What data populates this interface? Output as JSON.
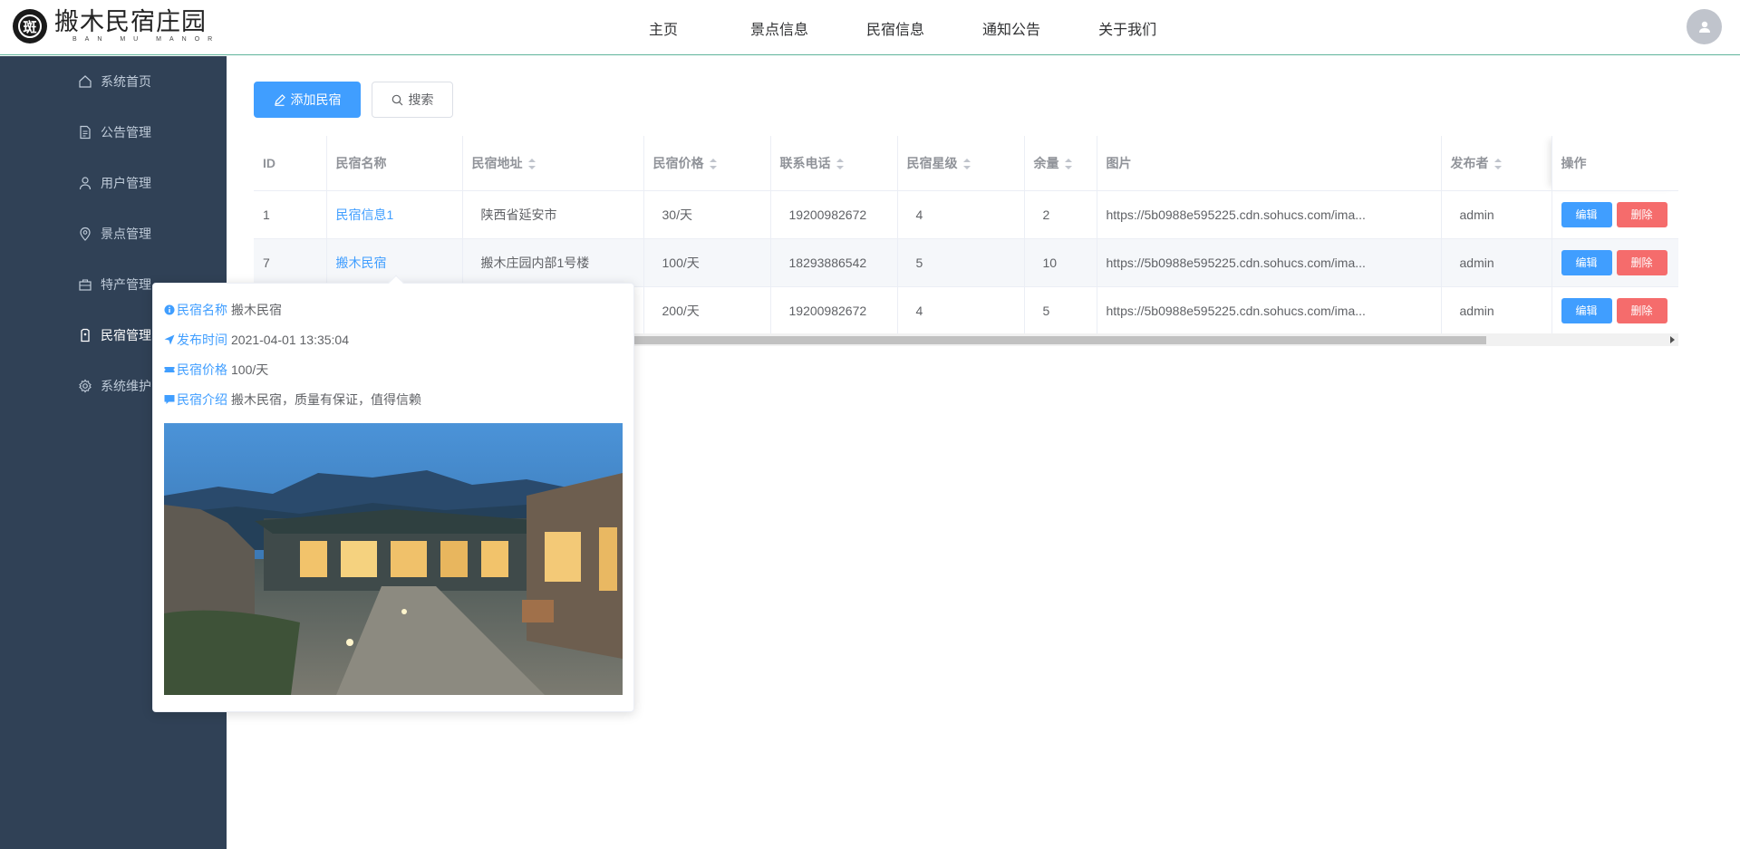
{
  "brand": {
    "name_cn": "搬木民宿庄园",
    "name_en": "BAN MU MANOR",
    "mark": "斑"
  },
  "topnav": [
    "主页",
    "景点信息",
    "民宿信息",
    "通知公告",
    "关于我们"
  ],
  "sidebar": {
    "items": [
      {
        "label": "系统首页",
        "icon": "home-icon"
      },
      {
        "label": "公告管理",
        "icon": "document-icon"
      },
      {
        "label": "用户管理",
        "icon": "user-icon"
      },
      {
        "label": "景点管理",
        "icon": "location-icon"
      },
      {
        "label": "特产管理",
        "icon": "shop-icon"
      },
      {
        "label": "民宿管理",
        "icon": "house-icon"
      },
      {
        "label": "系统维护",
        "icon": "gear-icon"
      }
    ],
    "active_index": 5
  },
  "toolbar": {
    "add_label": "添加民宿",
    "search_label": "搜索"
  },
  "table": {
    "columns": [
      "ID",
      "民宿名称",
      "民宿地址",
      "民宿价格",
      "联系电话",
      "民宿星级",
      "余量",
      "图片",
      "发布者",
      "操作"
    ],
    "sortable": [
      false,
      false,
      true,
      true,
      true,
      true,
      true,
      false,
      true,
      false
    ],
    "rows": [
      {
        "id": "1",
        "name": "民宿信息1",
        "address": "陕西省延安市",
        "price": "30/天",
        "phone": "19200982672",
        "stars": "4",
        "stock": "2",
        "image": "https://5b0988e595225.cdn.sohucs.com/ima...",
        "publisher": "admin"
      },
      {
        "id": "7",
        "name": "搬木民宿",
        "address": "搬木庄园内部1号楼",
        "price": "100/天",
        "phone": "18293886542",
        "stars": "5",
        "stock": "10",
        "image": "https://5b0988e595225.cdn.sohucs.com/ima...",
        "publisher": "admin"
      },
      {
        "id": "",
        "name": "",
        "address": "",
        "price": "200/天",
        "phone": "19200982672",
        "stars": "4",
        "stock": "5",
        "image": "https://5b0988e595225.cdn.sohucs.com/ima...",
        "publisher": "admin"
      }
    ],
    "edit_label": "编辑",
    "delete_label": "删除"
  },
  "popover": {
    "name_label": "民宿名称",
    "name_value": "搬木民宿",
    "time_label": "发布时间",
    "time_value": "2021-04-01 13:35:04",
    "price_label": "民宿价格",
    "price_value": "100/天",
    "intro_label": "民宿介绍",
    "intro_value": "搬木民宿，质量有保证，值得信赖"
  },
  "colors": {
    "primary": "#409eff",
    "danger": "#f56c6c",
    "sidebar_bg": "#304156",
    "header_border": "#5fb49b"
  }
}
